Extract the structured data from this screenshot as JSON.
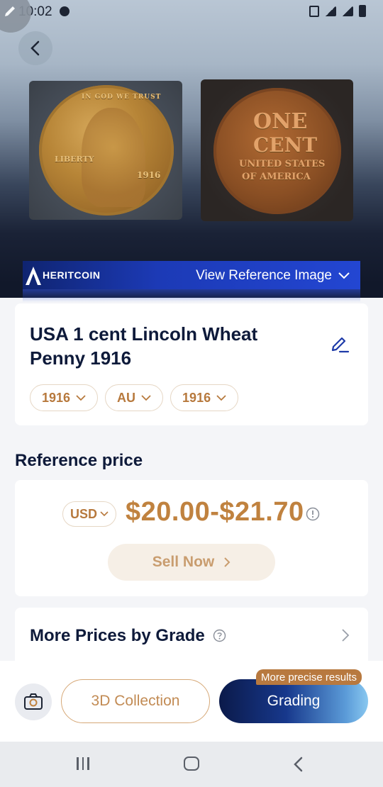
{
  "status_bar": {
    "time": "10:02"
  },
  "hero": {
    "brand": "HERITCOIN",
    "view_reference_label": "View Reference Image"
  },
  "coin": {
    "title": "USA 1 cent  Lincoln Wheat Penny 1916",
    "chips": [
      {
        "label": "1916"
      },
      {
        "label": "AU"
      },
      {
        "label": "1916"
      }
    ],
    "front_inscriptions": {
      "liberty": "LIBERTY",
      "year": "1916",
      "motto": "IN GOD WE TRUST"
    },
    "back_inscriptions": {
      "one": "ONE",
      "cent": "CENT",
      "united_states": "UNITED STATES",
      "of_america": "OF AMERICA"
    }
  },
  "reference_price": {
    "section_title": "Reference price",
    "currency": "USD",
    "price_range": "$20.00-$21.70",
    "sell_button": "Sell Now"
  },
  "more_prices": {
    "label": "More Prices by Grade"
  },
  "bottom_actions": {
    "collection_button": "3D Collection",
    "grading_button": "Grading",
    "promo_badge": "More precise results"
  },
  "colors": {
    "accent_gold": "#c0823f",
    "brand_blue": "#1c3ab6",
    "title_navy": "#0e1a3a"
  }
}
